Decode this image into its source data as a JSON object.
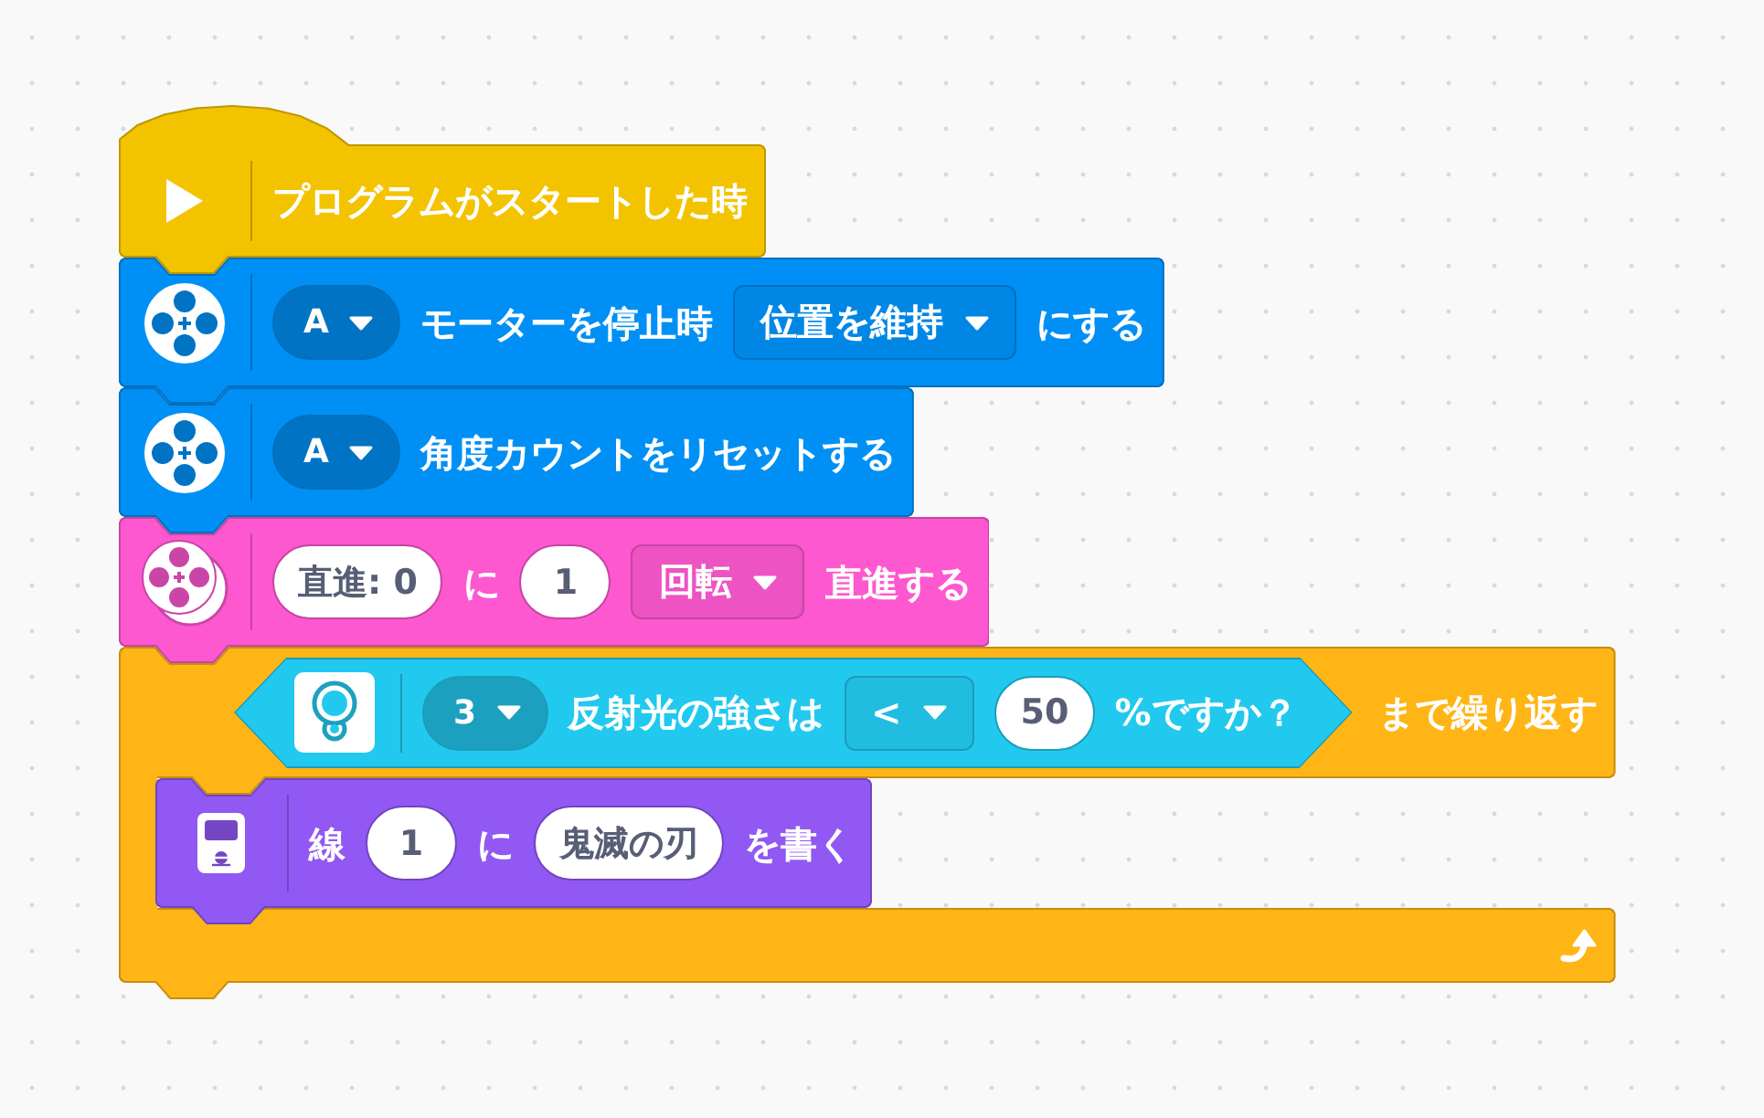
{
  "script": {
    "blocks": [
      {
        "kind": "hat",
        "color": "#f3c300",
        "parts": [
          {
            "kind": "label",
            "text": "プログラムがスタートした時"
          }
        ]
      },
      {
        "kind": "motor",
        "color": "#0090f5",
        "parts": [
          {
            "kind": "port_menu",
            "text": "A"
          },
          {
            "kind": "label",
            "text": "モーターを停止時"
          },
          {
            "kind": "menu",
            "text": "位置を維持"
          },
          {
            "kind": "label",
            "text": "にする"
          }
        ]
      },
      {
        "kind": "motor",
        "color": "#0090f5",
        "parts": [
          {
            "kind": "port_menu",
            "text": "A"
          },
          {
            "kind": "label",
            "text": "角度カウントをリセットする"
          }
        ]
      },
      {
        "kind": "movement",
        "color": "#fd58cf",
        "parts": [
          {
            "kind": "input",
            "value": "直進: 0"
          },
          {
            "kind": "label",
            "text": "に"
          },
          {
            "kind": "input",
            "value": "1"
          },
          {
            "kind": "menu",
            "text": "回転"
          },
          {
            "kind": "label",
            "text": "直進する"
          }
        ]
      },
      {
        "kind": "repeat",
        "color": "#ffb515",
        "condition": {
          "kind": "boolean",
          "color": "#22c9ef",
          "parts": [
            {
              "kind": "port_menu",
              "text": "3"
            },
            {
              "kind": "label",
              "text": "反射光の強さは"
            },
            {
              "kind": "menu",
              "text": "<"
            },
            {
              "kind": "input",
              "value": "50"
            },
            {
              "kind": "label",
              "text": "%ですか？"
            }
          ]
        },
        "parts": [
          {
            "kind": "label",
            "text": "まで繰り返す"
          }
        ],
        "children": [
          {
            "kind": "display",
            "color": "#9158f4",
            "parts": [
              {
                "kind": "label",
                "text": "線"
              },
              {
                "kind": "input",
                "value": "1"
              },
              {
                "kind": "label",
                "text": "に"
              },
              {
                "kind": "input",
                "value": "鬼滅の刃"
              },
              {
                "kind": "label",
                "text": "を書く"
              }
            ]
          }
        ]
      }
    ]
  }
}
